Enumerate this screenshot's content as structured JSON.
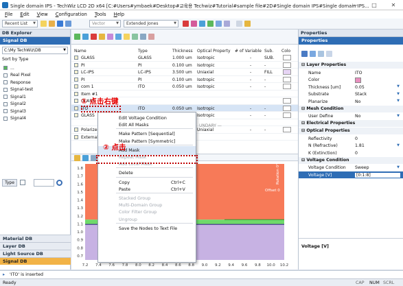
{
  "window": {
    "title": "Single domain IPS - TechWiz LCD 2D x64 [C:#Users#ymbaek#Desktop#교육용 Techwiz#Tutorial#sample file#2D#Single domain IPS#Single domain IPS...",
    "controls": [
      "—",
      "□",
      "✕"
    ]
  },
  "menu": [
    {
      "u": "F",
      "rest": "ile"
    },
    {
      "u": "E",
      "rest": "dit"
    },
    {
      "u": "V",
      "rest": "iew"
    },
    {
      "u": "C",
      "rest": "onfiguration"
    },
    {
      "u": "T",
      "rest": "ools"
    },
    {
      "u": "H",
      "rest": "elp"
    }
  ],
  "toolbar": {
    "recent_list": "Recent List",
    "vector_combo": "Vector",
    "method_combo": "Extended Jones"
  },
  "db_explorer": {
    "title": "DB Explorer",
    "tab": "Signal DB",
    "path": "C:\\My TechWiz\\DB",
    "sort": "Sort by Type",
    "items": [
      "...",
      "Real Pixel",
      "Response",
      "Signal-test",
      "Signal1",
      "Signal2",
      "Signal3",
      "Signal4"
    ],
    "type_button": "Type",
    "bottom_tabs": [
      "Material DB",
      "Layer DB",
      "Light Source DB",
      "Signal DB"
    ]
  },
  "layer_table": {
    "headers": [
      "Name",
      "Type",
      "Thickness",
      "Optical Property",
      "# of Variable",
      "Sub.",
      "Colo"
    ],
    "rows": [
      {
        "name": "GLASS",
        "type": "GLASS",
        "thickness": "1.000 um",
        "optical": "Isotropic",
        "vars": "-",
        "sub": "SUB.",
        "color": "#ffffff"
      },
      {
        "name": "PI",
        "type": "PI",
        "thickness": "0.100 um",
        "optical": "Isotropic",
        "vars": "-",
        "sub": "-",
        "color": "#ffffff"
      },
      {
        "name": "LC-IPS",
        "type": "LC-IPS",
        "thickness": "3.500 um",
        "optical": "Uniaxial",
        "vars": "-",
        "sub": "FILL",
        "color": "#e7d5f5"
      },
      {
        "name": "PI",
        "type": "PI",
        "thickness": "0.100 um",
        "optical": "Isotropic",
        "vars": "-",
        "sub": "-",
        "color": "#ffffff"
      },
      {
        "name": "com 1",
        "type": "ITO",
        "thickness": "0.050 um",
        "optical": "Isotropic",
        "vars": "-",
        "sub": "-",
        "color": "#ffffff"
      },
      {
        "name": "Item #1",
        "type": "",
        "thickness": "",
        "optical": "",
        "vars": "",
        "sub": "",
        "color": ""
      },
      {
        "name": "GLASS",
        "type": "",
        "thickness": "",
        "optical": "",
        "vars": "",
        "sub": "",
        "color": "#ffffff"
      },
      {
        "name": "ITO",
        "type": "ITO",
        "thickness": "0.050 um",
        "optical": "Isotropic",
        "vars": "-",
        "sub": "-",
        "color": "#ffffff"
      },
      {
        "name": "GLASS",
        "type": "",
        "thickness": "",
        "optical": "Isotropic",
        "vars": "-",
        "sub": "-",
        "color": "#ffffff"
      },
      {
        "name": "",
        "type": "",
        "thickness": "",
        "optical": "",
        "vars": "",
        "sub": "",
        "color": ""
      },
      {
        "name": "Polarizer",
        "type": "",
        "thickness": "",
        "optical": "Uniaxial",
        "vars": "-",
        "sub": "-",
        "color": "#ffffff"
      },
      {
        "name": "External R...",
        "type": "",
        "thickness": "",
        "optical": "",
        "vars": "",
        "sub": "",
        "color": ""
      }
    ],
    "boundary_text": "UNDARY —"
  },
  "graph": {
    "y_ticks": [
      "1.8",
      "1.7",
      "1.6",
      "1.5",
      "1.4",
      "1.3",
      "1.2",
      "1.1",
      "1.0",
      "0.9",
      "0.8",
      "0.7"
    ],
    "x_ticks": [
      "7.2",
      "7.4",
      "7.6",
      "7.8",
      "8.0",
      "8.2",
      "8.4",
      "8.6",
      "8.8",
      "9.0",
      "9.2",
      "9.4",
      "9.6",
      "9.8",
      "10.0",
      "10.2"
    ],
    "offset_label": "Offset 0",
    "side_label": "Rotation 0°",
    "colors": {
      "top": "#f77a58",
      "band": "#6fd96a",
      "bottom": "#c7b2e3"
    }
  },
  "context_menu": {
    "items": [
      {
        "label": "Edit Voltage Condition",
        "shortcut": "",
        "disabled": false
      },
      {
        "label": "Edit All Masks",
        "shortcut": "",
        "disabled": false
      },
      {
        "sep": true
      },
      {
        "label": "Make Pattern [Sequential]",
        "shortcut": "",
        "disabled": false
      },
      {
        "label": "Make Pattern [Symmetric]",
        "shortcut": "",
        "disabled": false
      },
      {
        "sep": true
      },
      {
        "label": "Add Mask",
        "shortcut": "",
        "disabled": false,
        "highlight": true
      },
      {
        "label": "Repeat Mask",
        "shortcut": "",
        "disabled": true
      },
      {
        "label": "Add Local Mask",
        "shortcut": "",
        "disabled": true
      },
      {
        "sep": true
      },
      {
        "label": "Delete",
        "shortcut": "",
        "disabled": false
      },
      {
        "sep": true
      },
      {
        "label": "Copy",
        "shortcut": "Ctrl+C",
        "disabled": false
      },
      {
        "label": "Paste",
        "shortcut": "Ctrl+V",
        "disabled": false
      },
      {
        "sep": true
      },
      {
        "label": "Stacked Group",
        "shortcut": "",
        "disabled": true
      },
      {
        "label": "Multi-Domain Group",
        "shortcut": "",
        "disabled": true
      },
      {
        "label": "Color Filter Group",
        "shortcut": "",
        "disabled": true
      },
      {
        "label": "Ungroup",
        "shortcut": "",
        "disabled": true
      },
      {
        "sep": true
      },
      {
        "label": "Save the Nodes to Text File",
        "shortcut": "",
        "disabled": false
      }
    ]
  },
  "annotations": {
    "step1": "① 点击右键",
    "step2": "② 点击"
  },
  "properties": {
    "title": "Properties",
    "tab": "Properties",
    "sections": [
      {
        "name": "Layer Properties",
        "rows": [
          {
            "k": "Name",
            "v": "ITO"
          },
          {
            "k": "Color",
            "v": "",
            "color": "#e98fbf"
          },
          {
            "k": "Thickness [um]",
            "v": "0.05"
          },
          {
            "k": "Substrate",
            "v": "Stack"
          },
          {
            "k": "Planarize",
            "v": "No"
          }
        ]
      },
      {
        "name": "Mesh Condition",
        "rows": [
          {
            "k": "User Define",
            "v": "No"
          }
        ]
      },
      {
        "name": "Electrical Properties",
        "rows": []
      },
      {
        "name": "Optical Properties",
        "rows": [
          {
            "k": "Reflectivity",
            "v": "0"
          },
          {
            "k": "N (Refractive)",
            "v": "1.81"
          },
          {
            "k": "K (Extinction)",
            "v": "0"
          }
        ]
      },
      {
        "name": "Voltage Condition",
        "rows": [
          {
            "k": "Voltage Condition",
            "v": "Sweep"
          },
          {
            "k": "Voltage [V]",
            "v": "[0:1:8]",
            "selected": true
          }
        ]
      }
    ],
    "description_title": "Voltage [V]"
  },
  "status": {
    "log": "'ITO' is inserted",
    "ready": "Ready",
    "indicators": [
      "CAP",
      "NUM",
      "SCRL"
    ]
  }
}
